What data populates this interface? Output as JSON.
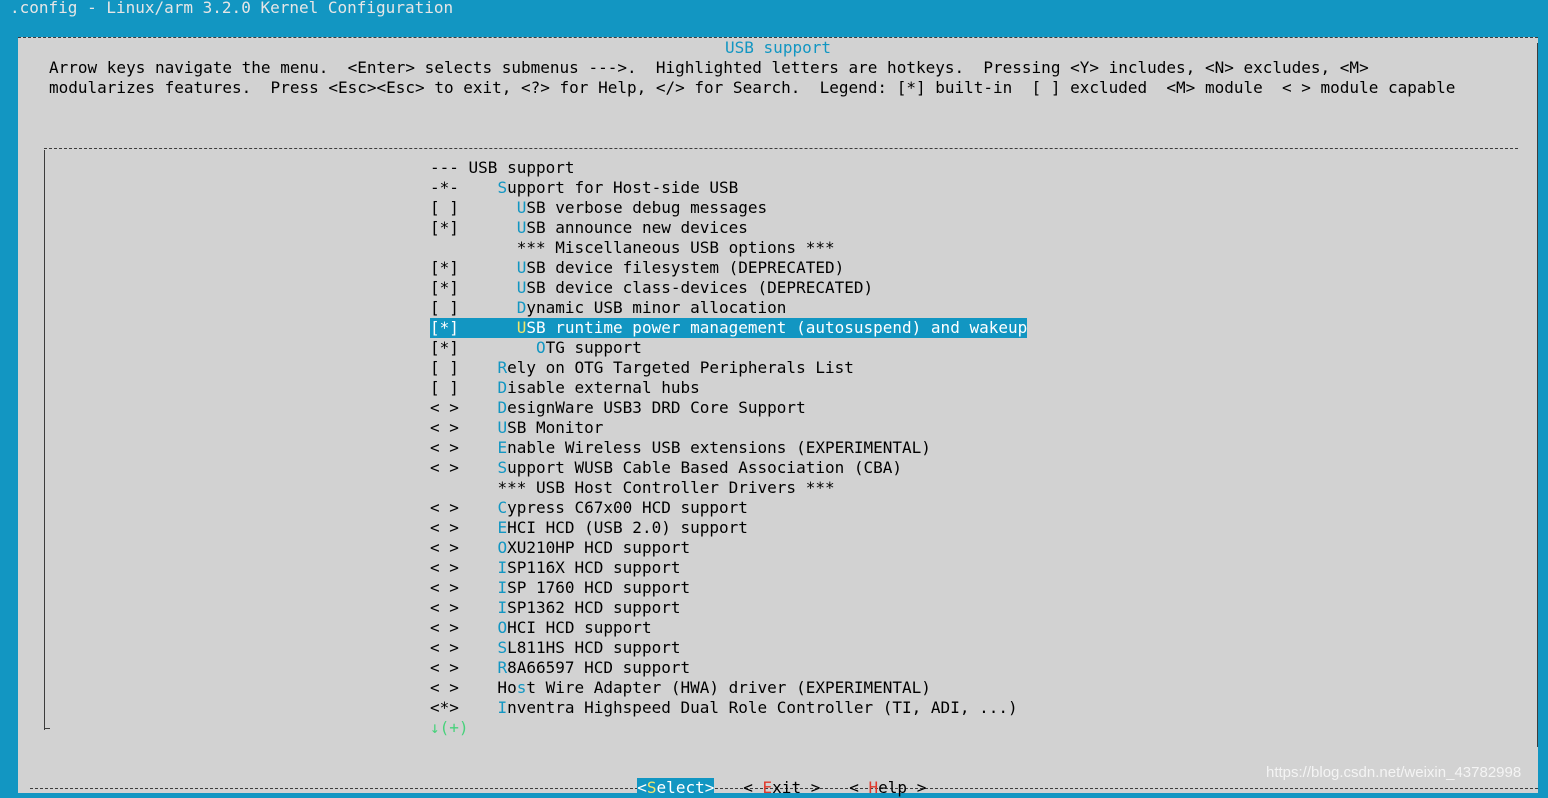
{
  "backtitle": ".config - Linux/arm 3.2.0 Kernel Configuration",
  "dialog": {
    "title": "USB support",
    "help_line1": "Arrow keys navigate the menu.  <Enter> selects submenus --->.  Highlighted letters are hotkeys.  Pressing <Y> includes, <N> excludes, <M>",
    "help_line2": "modularizes features.  Press <Esc><Esc> to exit, <?> for Help, </> for Search.  Legend: [*] built-in  [ ] excluded  <M> module  < > module capable"
  },
  "menu": {
    "items": [
      {
        "prefix": "--- ",
        "hot": "",
        "rest": "USB support"
      },
      {
        "prefix": "-*-    ",
        "hot": "S",
        "rest": "upport for Host-side USB"
      },
      {
        "prefix": "[ ]      ",
        "hot": "U",
        "rest": "SB verbose debug messages"
      },
      {
        "prefix": "[*]      ",
        "hot": "U",
        "rest": "SB announce new devices"
      },
      {
        "prefix": "         ",
        "hot": "",
        "rest": "*** Miscellaneous USB options ***"
      },
      {
        "prefix": "[*]      ",
        "hot": "U",
        "rest": "SB device filesystem (DEPRECATED)"
      },
      {
        "prefix": "[*]      ",
        "hot": "U",
        "rest": "SB device class-devices (DEPRECATED)"
      },
      {
        "prefix": "[ ]      ",
        "hot": "D",
        "rest": "ynamic USB minor allocation"
      },
      {
        "prefix": "[*]      ",
        "hot": "U",
        "rest": "SB runtime power management (autosuspend) and wakeup"
      },
      {
        "prefix": "[*]        ",
        "hot": "O",
        "rest": "TG support"
      },
      {
        "prefix": "[ ]    ",
        "hot": "R",
        "rest": "ely on OTG Targeted Peripherals List"
      },
      {
        "prefix": "[ ]    ",
        "hot": "D",
        "rest": "isable external hubs"
      },
      {
        "prefix": "< >    ",
        "hot": "D",
        "rest": "esignWare USB3 DRD Core Support"
      },
      {
        "prefix": "< >    ",
        "hot": "U",
        "rest": "SB Monitor"
      },
      {
        "prefix": "< >    ",
        "hot": "E",
        "rest": "nable Wireless USB extensions (EXPERIMENTAL)"
      },
      {
        "prefix": "< >    ",
        "hot": "S",
        "rest": "upport WUSB Cable Based Association (CBA)"
      },
      {
        "prefix": "       ",
        "hot": "",
        "rest": "*** USB Host Controller Drivers ***"
      },
      {
        "prefix": "< >    ",
        "hot": "C",
        "rest": "ypress C67x00 HCD support"
      },
      {
        "prefix": "< >    ",
        "hot": "E",
        "rest": "HCI HCD (USB 2.0) support"
      },
      {
        "prefix": "< >    ",
        "hot": "O",
        "rest": "XU210HP HCD support"
      },
      {
        "prefix": "< >    ",
        "hot": "I",
        "rest": "SP116X HCD support"
      },
      {
        "prefix": "< >    ",
        "hot": "I",
        "rest": "SP 1760 HCD support"
      },
      {
        "prefix": "< >    ",
        "hot": "I",
        "rest": "SP1362 HCD support"
      },
      {
        "prefix": "< >    ",
        "hot": "O",
        "rest": "HCI HCD support"
      },
      {
        "prefix": "< >    ",
        "hot": "S",
        "rest": "L811HS HCD support"
      },
      {
        "prefix": "< >    ",
        "hot": "R",
        "rest": "8A66597 HCD support"
      },
      {
        "prefix": "< >    Ho",
        "hot": "s",
        "rest": "t Wire Adapter (HWA) driver (EXPERIMENTAL)"
      },
      {
        "prefix": "<*>    ",
        "hot": "I",
        "rest": "nventra Highspeed Dual Role Controller (TI, ADI, ...)"
      }
    ],
    "more_indicator": "↓(+)"
  },
  "buttons": {
    "select": {
      "open": "<",
      "hot": "S",
      "rest": "elect",
      "close": ">"
    },
    "exit": {
      "open": "< ",
      "hot": "E",
      "rest": "xit",
      "close": " >"
    },
    "help": {
      "open": "< ",
      "hot": "H",
      "rest": "elp",
      "close": " >"
    }
  },
  "watermark": "https://blog.csdn.net/weixin_43782998"
}
